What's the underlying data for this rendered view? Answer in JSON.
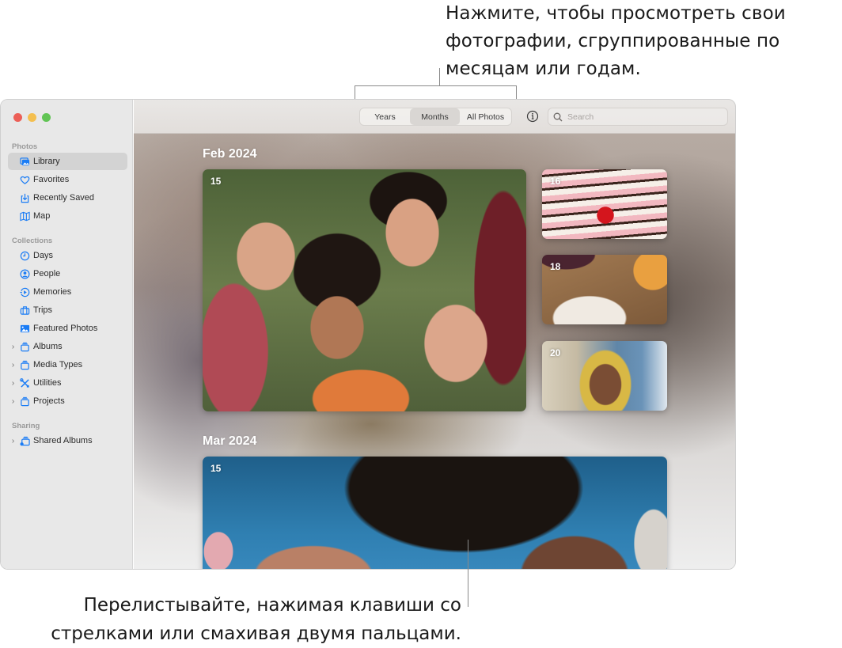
{
  "callouts": {
    "top": {
      "lines": [
        "Нажмите, чтобы просмотреть свои",
        "фотографии, сгруппированные по",
        "месяцам или годам."
      ]
    },
    "bottom": {
      "lines": [
        "Перелистывайте, нажимая клавиши со",
        "стрелками или смахивая двумя пальцами."
      ]
    }
  },
  "window": {
    "traffic_lights": [
      "close",
      "minimize",
      "zoom"
    ],
    "sidebar": {
      "sections": [
        {
          "label": "Photos",
          "items": [
            {
              "label": "Library",
              "icon": "photo-library-icon",
              "active": true,
              "chevron": false
            },
            {
              "label": "Favorites",
              "icon": "heart-icon",
              "active": false,
              "chevron": false
            },
            {
              "label": "Recently Saved",
              "icon": "download-tray-icon",
              "active": false,
              "chevron": false
            },
            {
              "label": "Map",
              "icon": "map-icon",
              "active": false,
              "chevron": false
            }
          ]
        },
        {
          "label": "Collections",
          "items": [
            {
              "label": "Days",
              "icon": "clock-icon",
              "active": false,
              "chevron": false
            },
            {
              "label": "People",
              "icon": "person-circle-icon",
              "active": false,
              "chevron": false
            },
            {
              "label": "Memories",
              "icon": "memories-icon",
              "active": false,
              "chevron": false
            },
            {
              "label": "Trips",
              "icon": "suitcase-icon",
              "active": false,
              "chevron": false
            },
            {
              "label": "Featured Photos",
              "icon": "photo-icon",
              "active": false,
              "chevron": false
            },
            {
              "label": "Albums",
              "icon": "album-stack-icon",
              "active": false,
              "chevron": true
            },
            {
              "label": "Media Types",
              "icon": "album-stack-icon",
              "active": false,
              "chevron": true
            },
            {
              "label": "Utilities",
              "icon": "tools-icon",
              "active": false,
              "chevron": true
            },
            {
              "label": "Projects",
              "icon": "album-stack-icon",
              "active": false,
              "chevron": true
            }
          ]
        },
        {
          "label": "Sharing",
          "items": [
            {
              "label": "Shared Albums",
              "icon": "shared-album-icon",
              "active": false,
              "chevron": true
            }
          ]
        }
      ]
    },
    "toolbar": {
      "view_options": [
        {
          "label": "Years",
          "selected": false
        },
        {
          "label": "Months",
          "selected": true
        },
        {
          "label": "All Photos",
          "selected": false
        }
      ],
      "info_icon": "info-circle-icon",
      "search": {
        "placeholder": "Search",
        "value": ""
      }
    },
    "months": [
      {
        "title": "Feb 2024",
        "photos": [
          {
            "day": "15",
            "subject": "group selfie of four friends"
          },
          {
            "day": "16",
            "subject": "layered cake with cherry"
          },
          {
            "day": "18",
            "subject": "plate of roasted carrots"
          },
          {
            "day": "20",
            "subject": "person in yellow hood at beach"
          }
        ]
      },
      {
        "title": "Mar 2024",
        "photos": [
          {
            "day": "15",
            "subject": "two people lying heads together"
          }
        ]
      }
    ]
  },
  "colors": {
    "accent_blue": "#1a7cf5",
    "traffic_red": "#ec5f57",
    "traffic_yellow": "#f4bf4f",
    "traffic_green": "#61c454"
  }
}
